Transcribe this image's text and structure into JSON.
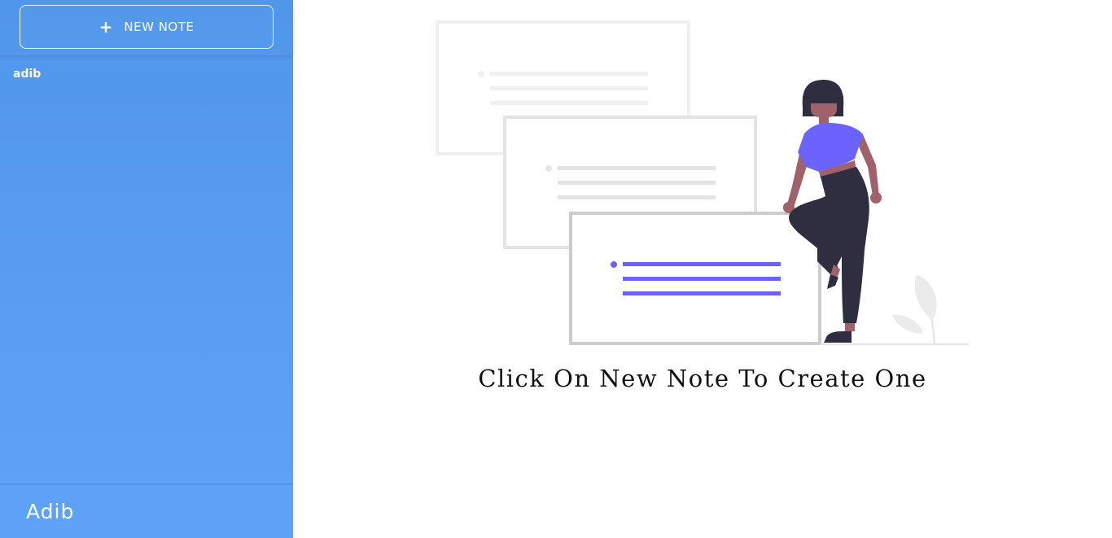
{
  "sidebar": {
    "new_note_label": "NEW NOTE",
    "new_note_icon": "plus-icon",
    "notes": [
      {
        "title": "adib"
      }
    ],
    "user_name": "Adib"
  },
  "main": {
    "empty_message": "Click On New Note To Create One"
  },
  "colors": {
    "sidebar_top": "#5096ea",
    "sidebar_bottom": "#5fa3f8",
    "accent_purple": "#6c63ff",
    "figure_dark": "#2f2e41",
    "skin": "#a0616a"
  }
}
